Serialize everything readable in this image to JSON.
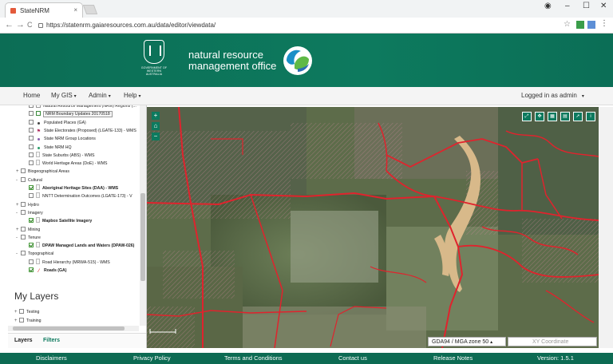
{
  "browser": {
    "tab_title": "StateNRM",
    "tab_close": "×",
    "url": "https://statenrm.gaiaresources.com.au/data/editor/viewdata/",
    "back": "←",
    "forward": "→",
    "reload": "C",
    "star": "☆",
    "min": "–",
    "max": "☐",
    "close": "✕",
    "profile": "◉"
  },
  "header": {
    "gov_text": "GOVERNMENT OF WESTERN AUSTRALIA",
    "title_line1": "natural resource",
    "title_line2": "management office"
  },
  "menu": {
    "home": "Home",
    "my_gis": "My GIS",
    "admin": "Admin",
    "help": "Help",
    "logged_in": "Logged in as admin",
    "caret": "▾"
  },
  "tree": [
    {
      "indent": 1,
      "chk": false,
      "sym": "sq",
      "label": "Natural Resource Management (NRM) Regions (..."
    },
    {
      "indent": 1,
      "chk": false,
      "sym": "tip-box",
      "label": "NRM Boundary Updates 20170518",
      "highlight": true
    },
    {
      "indent": 1,
      "chk": false,
      "sym": "dot",
      "label": "Populated Places (GA)"
    },
    {
      "indent": 1,
      "chk": false,
      "sym": "flag",
      "label": "State Electorates (Proposed) (LGATE-133) - WMS"
    },
    {
      "indent": 1,
      "chk": false,
      "sym": "pur",
      "label": "State NRM Group Locations"
    },
    {
      "indent": 1,
      "chk": false,
      "sym": "grn",
      "label": "State NRM HQ"
    },
    {
      "indent": 1,
      "chk": false,
      "sym": "doc",
      "label": "State Suburbs (ABS) - WMS"
    },
    {
      "indent": 1,
      "chk": false,
      "sym": "doc",
      "label": "World Heritage Areas (DoE) - WMS"
    },
    {
      "indent": 0,
      "toggle": "+",
      "chk": false,
      "label": "Biogeographical Areas"
    },
    {
      "indent": 0,
      "toggle": "-",
      "chk": false,
      "label": "Cultural"
    },
    {
      "indent": 1,
      "chk": true,
      "sym": "doc",
      "label": "Aboriginal Heritage Sites (DAA) - WMS",
      "bold": true
    },
    {
      "indent": 1,
      "chk": false,
      "sym": "doc",
      "label": "NNTT Determination Outcomes (LGATE-173) - V"
    },
    {
      "indent": 0,
      "toggle": "+",
      "chk": false,
      "label": "Hydro"
    },
    {
      "indent": 0,
      "toggle": "-",
      "chk": false,
      "label": "Imagery"
    },
    {
      "indent": 1,
      "chk": true,
      "sym": "doc",
      "label": "Mapbox Satellite Imagery",
      "bold": true
    },
    {
      "indent": 0,
      "toggle": "+",
      "chk": false,
      "label": "Mining"
    },
    {
      "indent": 0,
      "toggle": "-",
      "chk": false,
      "label": "Tenure"
    },
    {
      "indent": 1,
      "chk": true,
      "sym": "doc",
      "label": "DPAW Managed Lands and Waters (DPAW-026)",
      "bold": true
    },
    {
      "indent": 0,
      "toggle": "-",
      "chk": false,
      "label": "Topographical"
    },
    {
      "indent": 1,
      "chk": false,
      "sym": "doc",
      "label": "Road Hierarchy (MRWA-515) - WMS"
    },
    {
      "indent": 1,
      "chk": true,
      "sym": "line",
      "label": "Roads (GA)",
      "bold": true
    }
  ],
  "my_layers": {
    "title": "My Layers",
    "items": [
      {
        "label": "Testing"
      },
      {
        "label": "Training"
      }
    ]
  },
  "sidebar_tabs": {
    "layers": "Layers",
    "filters": "Filters"
  },
  "map": {
    "projection": "GDA94 / MGA zone 50",
    "xy_placeholder": "XY Coordinate",
    "zoom_in": "+",
    "zoom_out": "−",
    "home": "⌂"
  },
  "footer": {
    "disclaimers": "Disclaimers",
    "privacy": "Privacy Policy",
    "terms": "Terms and Conditions",
    "contact": "Contact us",
    "release": "Release Notes",
    "version": "Version: 1.5.1"
  },
  "colors": {
    "brand_green": "#0d7a5e",
    "footer_green": "#0d6b53",
    "road_red": "#e0232d",
    "water_tan": "#d8b98a"
  }
}
